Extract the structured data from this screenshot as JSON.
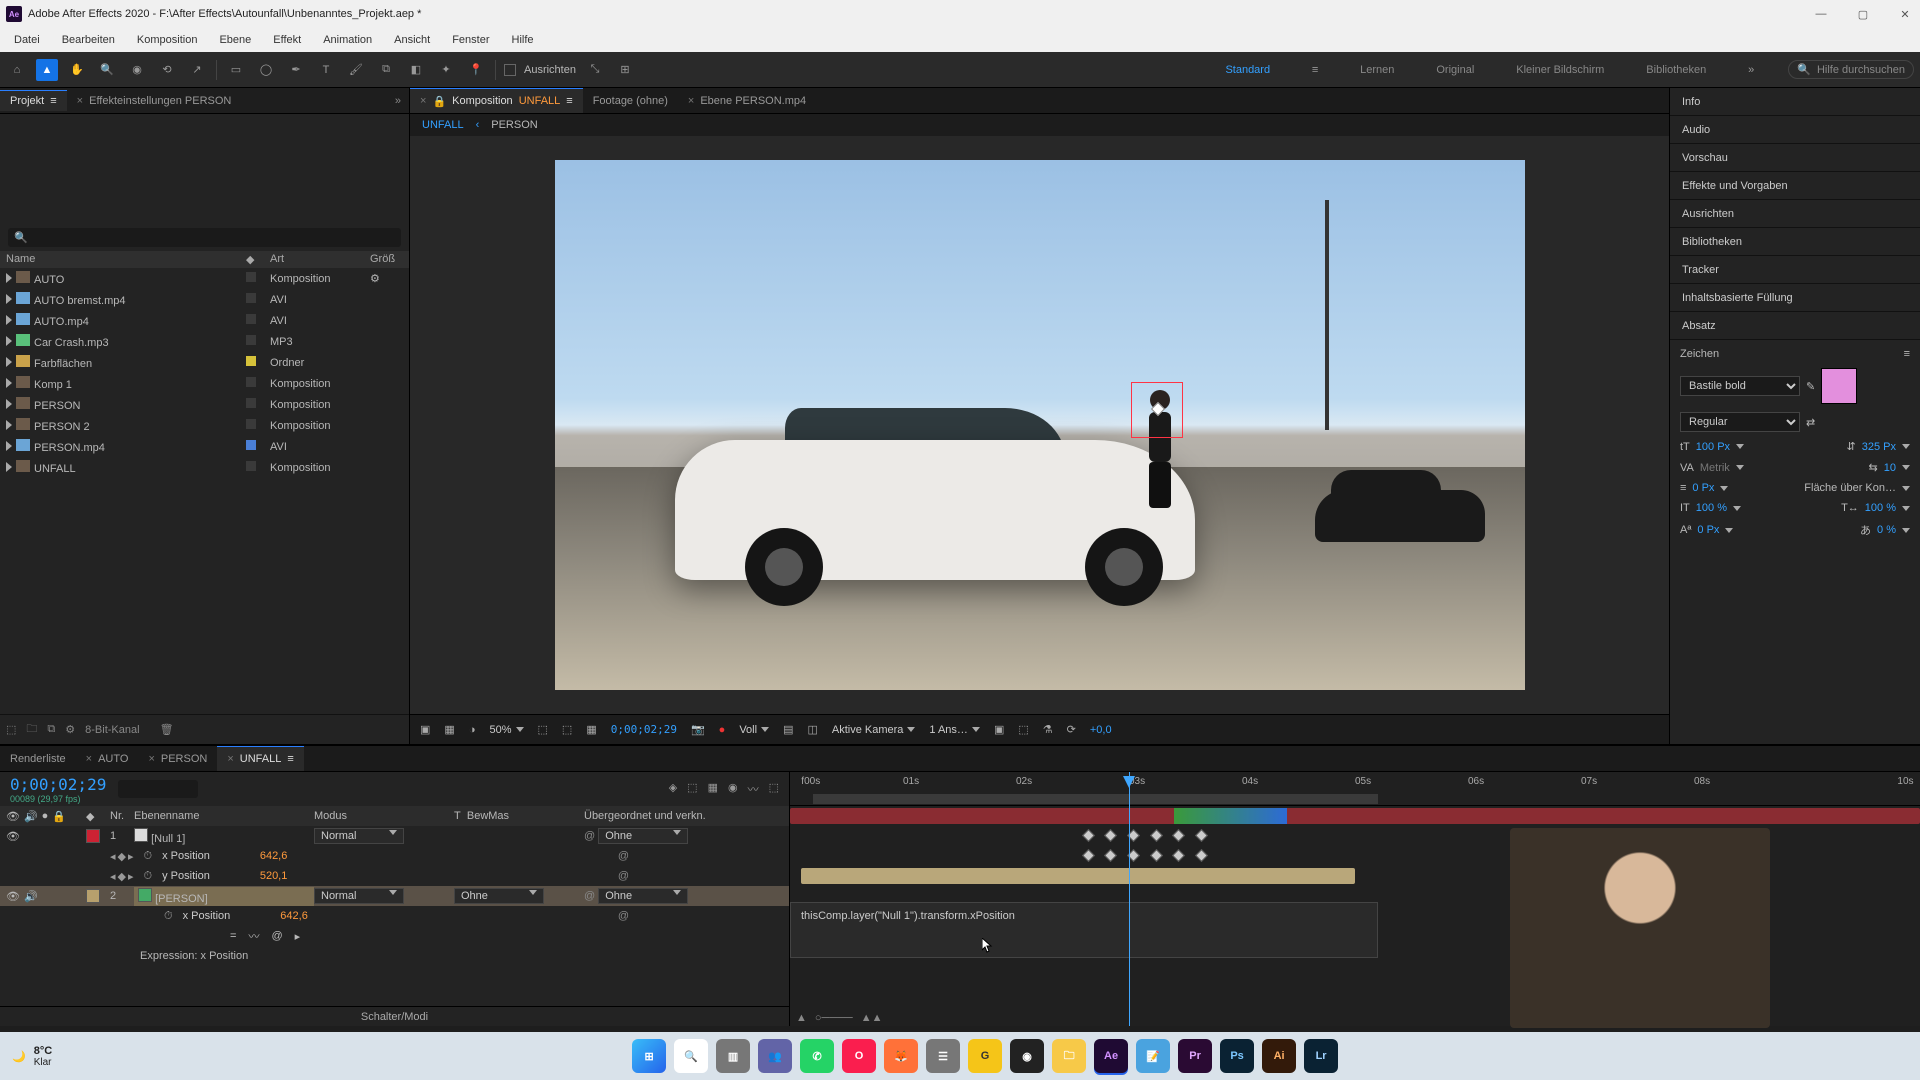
{
  "title": "Adobe After Effects 2020 - F:\\After Effects\\Autounfall\\Unbenanntes_Projekt.aep *",
  "menu": [
    "Datei",
    "Bearbeiten",
    "Komposition",
    "Ebene",
    "Effekt",
    "Animation",
    "Ansicht",
    "Fenster",
    "Hilfe"
  ],
  "toolbar": {
    "align_label": "Ausrichten",
    "workspaces": [
      "Standard",
      "Lernen",
      "Original",
      "Kleiner Bildschirm",
      "Bibliotheken"
    ],
    "search_placeholder": "Hilfe durchsuchen"
  },
  "project_panel": {
    "tab_project": "Projekt",
    "tab_effect": "Effekteinstellungen PERSON",
    "search_icon": "🔍",
    "headers": {
      "name": "Name",
      "art": "Art",
      "size": "Größ"
    },
    "items": [
      {
        "name": "AUTO",
        "type": "Komposition",
        "icon": "comp",
        "chip": "plain",
        "action": true
      },
      {
        "name": "AUTO bremst.mp4",
        "type": "AVI",
        "icon": "avi",
        "chip": "plain"
      },
      {
        "name": "AUTO.mp4",
        "type": "AVI",
        "icon": "avi",
        "chip": "plain"
      },
      {
        "name": "Car Crash.mp3",
        "type": "MP3",
        "icon": "mp3",
        "chip": "plain"
      },
      {
        "name": "Farbflächen",
        "type": "Ordner",
        "icon": "folder",
        "chip": "yellow"
      },
      {
        "name": "Komp 1",
        "type": "Komposition",
        "icon": "comp",
        "chip": "plain"
      },
      {
        "name": "PERSON",
        "type": "Komposition",
        "icon": "comp",
        "chip": "plain"
      },
      {
        "name": "PERSON 2",
        "type": "Komposition",
        "icon": "comp",
        "chip": "plain"
      },
      {
        "name": "PERSON.mp4",
        "type": "AVI",
        "icon": "avi",
        "chip": "blue"
      },
      {
        "name": "UNFALL",
        "type": "Komposition",
        "icon": "comp",
        "chip": "plain"
      }
    ],
    "bit_label": "8-Bit-Kanal"
  },
  "viewer": {
    "tab_comp_prefix": "Komposition",
    "tab_comp_name": "UNFALL",
    "tab_footage": "Footage (ohne)",
    "tab_layer": "Ebene PERSON.mp4",
    "crumb_active": "UNFALL",
    "crumb_second": "PERSON",
    "footer": {
      "zoom": "50%",
      "timecode": "0;00;02;29",
      "res": "Voll",
      "camera": "Aktive Kamera",
      "views": "1 Ans…",
      "exposure": "+0,0"
    }
  },
  "right_panels": [
    "Info",
    "Audio",
    "Vorschau",
    "Effekte und Vorgaben",
    "Ausrichten",
    "Bibliotheken",
    "Tracker",
    "Inhaltsbasierte Füllung",
    "Absatz"
  ],
  "char_panel": {
    "title": "Zeichen",
    "font": "Bastile bold",
    "style": "Regular",
    "size": "100 Px",
    "leading": "325 Px",
    "kerning": "Metrik",
    "tracking": "10",
    "stroke": "0 Px",
    "fill_over": "Fläche über Kon…",
    "vscale": "100 %",
    "hscale": "100 %",
    "baseline": "0 Px",
    "tsume": "0 %"
  },
  "timeline": {
    "tab_render": "Renderliste",
    "tab_auto": "AUTO",
    "tab_person": "PERSON",
    "tab_unfall": "UNFALL",
    "timecode": "0;00;02;29",
    "subtime": "00089 (29,97 fps)",
    "cols": {
      "nr": "Nr.",
      "layer": "Ebenenname",
      "mode": "Modus",
      "t": "T",
      "bewmas": "BewMas",
      "parent": "Übergeordnet und verkn."
    },
    "layers": [
      {
        "num": "1",
        "name": "[Null 1]",
        "mode": "Normal",
        "parent": "Ohne",
        "color": "red",
        "props": [
          {
            "name": "x Position",
            "val": "642,6"
          },
          {
            "name": "y Position",
            "val": "520,1"
          }
        ]
      },
      {
        "num": "2",
        "name": "[PERSON]",
        "mode": "Normal",
        "bewmas": "Ohne",
        "parent": "Ohne",
        "color": "tan",
        "selected": true,
        "props": [
          {
            "name": "x Position",
            "val": "642,6"
          }
        ]
      }
    ],
    "expression_label": "Expression: x Position",
    "expression_code": "thisComp.layer(\"Null 1\").transform.xPosition",
    "footer": "Schalter/Modi",
    "ruler": [
      "f00s",
      "01s",
      "02s",
      "03s",
      "04s",
      "05s",
      "06s",
      "07s",
      "08s",
      "10s"
    ]
  },
  "taskbar": {
    "temp": "8°C",
    "cond": "Klar",
    "apps": [
      "win",
      "search",
      "tasks",
      "teams",
      "whatsapp",
      "opera",
      "firefox",
      "app1",
      "app2",
      "obs",
      "explorer",
      "ae",
      "notes",
      "pr",
      "ps",
      "ai",
      "lr"
    ]
  }
}
